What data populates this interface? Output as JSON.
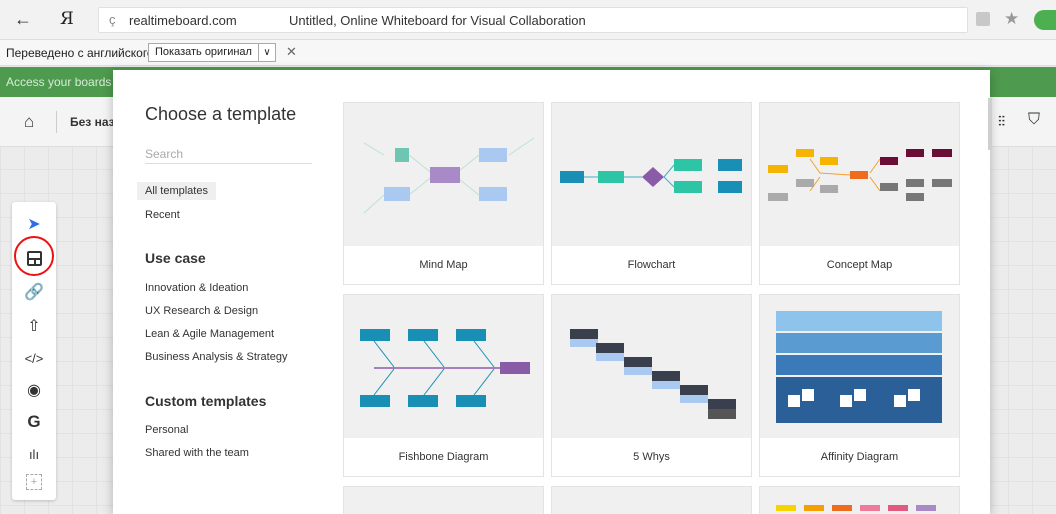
{
  "browser": {
    "back_glyph": "←",
    "ya_logo": "Я",
    "reload_glyph": "ç",
    "domain": "realtimeboard.com",
    "page_title": "Untitled, Online Whiteboard for Visual Collaboration",
    "star_glyph": "★",
    "translate": {
      "text": "Переведено с английского",
      "show_original": "Показать оригинал",
      "dropdown_glyph": "∨",
      "close_glyph": "✕"
    }
  },
  "app": {
    "banner_text": "Access your boards",
    "home_glyph": "⌂",
    "board_name": "Без наз",
    "filters_glyph": "⫶⫶",
    "learn_glyph": "⛉",
    "toolbar": {
      "cursor_glyph": "➤",
      "link_glyph": "🔗",
      "upload_glyph": "⇧",
      "embed_glyph": "</>",
      "eye_glyph": "◉",
      "g_glyph": "G",
      "chart_glyph": "ılı",
      "plus_glyph": "+"
    }
  },
  "modal": {
    "title": "Choose a template",
    "search_placeholder": "Search",
    "nav": {
      "all": "All templates",
      "recent": "Recent",
      "use_case_heading": "Use case",
      "use_cases": [
        "Innovation & Ideation",
        "UX Research & Design",
        "Lean & Agile Management",
        "Business Analysis & Strategy"
      ],
      "custom_heading": "Custom templates",
      "custom": [
        "Personal",
        "Shared with the team"
      ]
    },
    "templates": [
      "Mind Map",
      "Flowchart",
      "Concept Map",
      "Fishbone Diagram",
      "5 Whys",
      "Affinity Diagram"
    ]
  },
  "colors": {
    "banner": "#4e9a4e",
    "highlight": "#e11111",
    "cursor": "#2f6ee6"
  }
}
